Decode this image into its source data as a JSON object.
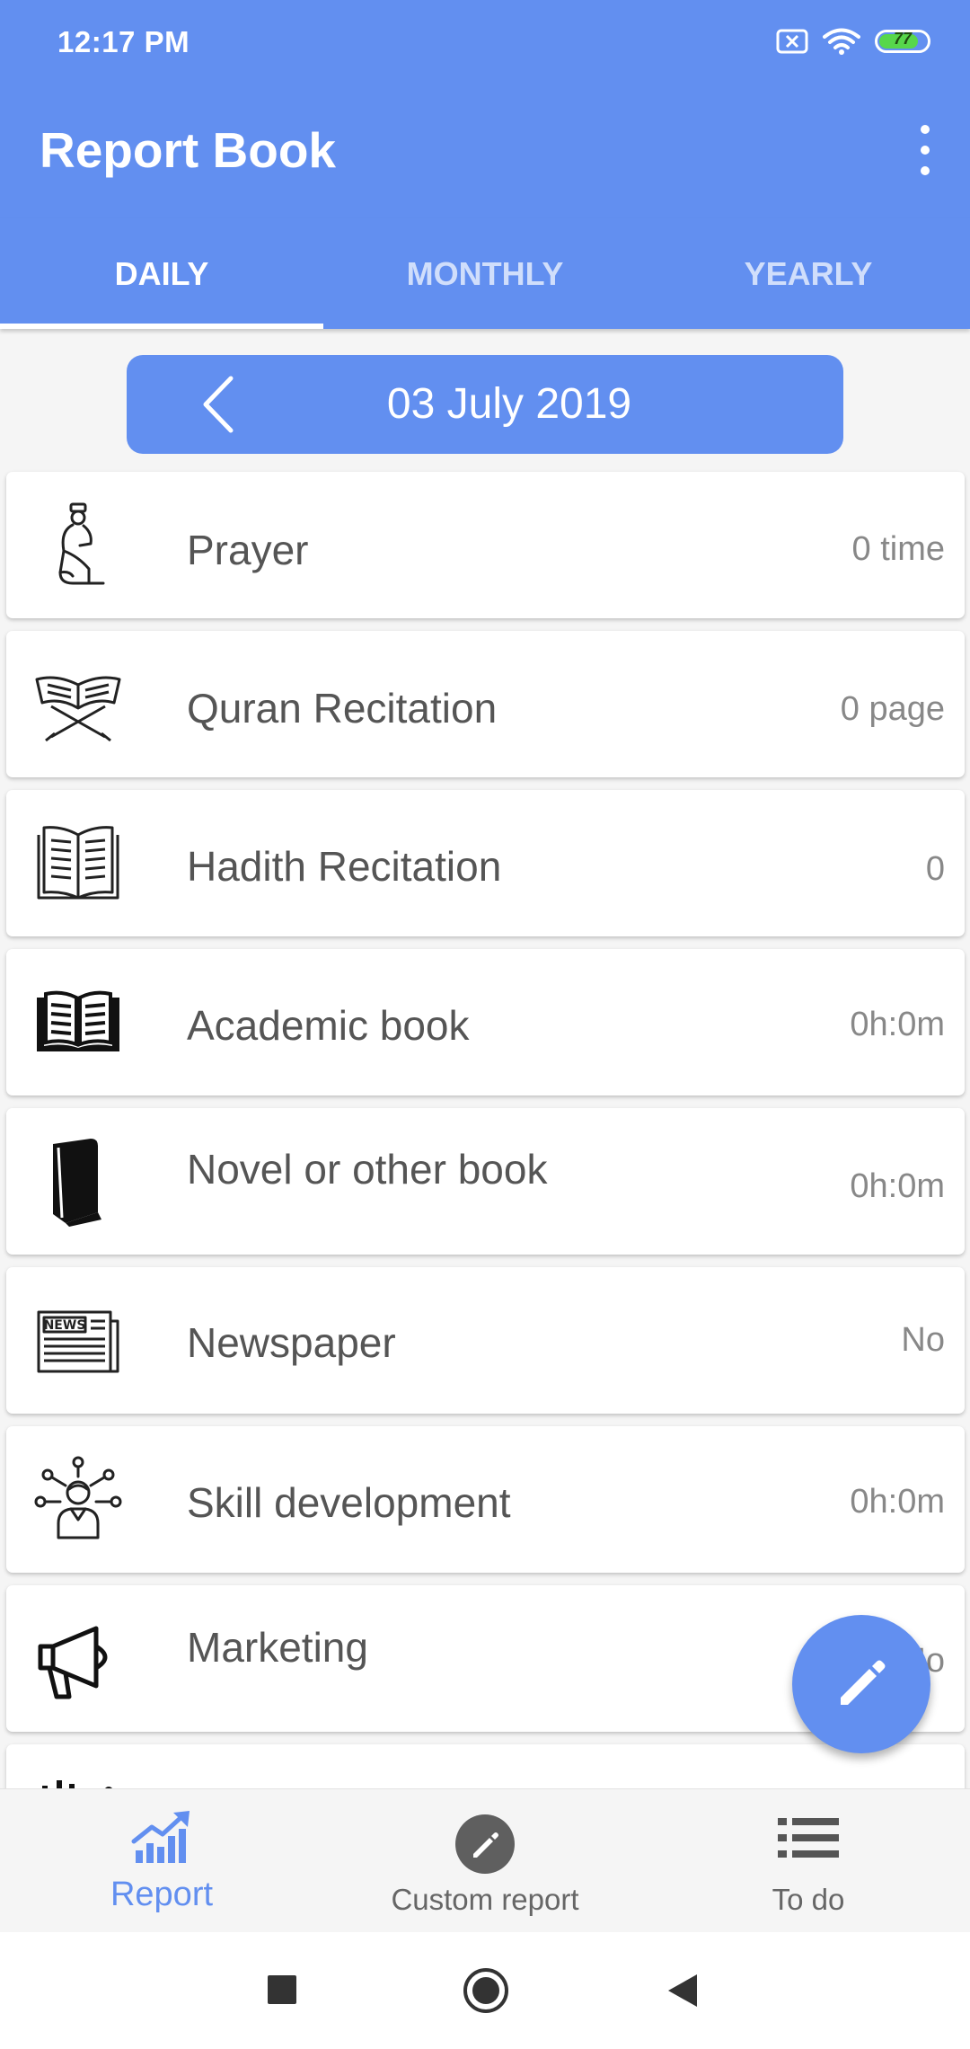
{
  "status_bar": {
    "time": "12:17 PM",
    "battery": "77"
  },
  "app_bar": {
    "title": "Report Book",
    "menu_icon": "more-vert-icon"
  },
  "tabs": [
    {
      "label": "DAILY",
      "active": true
    },
    {
      "label": "MONTHLY",
      "active": false
    },
    {
      "label": "YEARLY",
      "active": false
    }
  ],
  "date_selector": {
    "date": "03 July 2019",
    "prev_icon": "chevron-left-icon"
  },
  "items": [
    {
      "label": "Prayer",
      "value": "0 time",
      "icon": "prayer-icon"
    },
    {
      "label": "Quran Recitation",
      "value": "0 page",
      "icon": "quran-icon"
    },
    {
      "label": "Hadith Recitation",
      "value": "0",
      "icon": "hadith-book-icon"
    },
    {
      "label": "Academic book",
      "value": "0h:0m",
      "icon": "open-book-icon"
    },
    {
      "label": "Novel or other book",
      "value": "0h:0m",
      "icon": "closed-book-icon"
    },
    {
      "label": "Newspaper",
      "value": "No",
      "icon": "newspaper-icon"
    },
    {
      "label": "Skill development",
      "value": "0h:0m",
      "icon": "skill-icon"
    },
    {
      "label": "Marketing",
      "value": "No",
      "icon": "megaphone-icon"
    }
  ],
  "newspaper_icon_text": "NEWS",
  "fab": {
    "icon": "pencil-icon"
  },
  "bottom_nav": [
    {
      "label": "Report",
      "icon": "chart-up-icon",
      "active": true
    },
    {
      "label": "Custom report",
      "icon": "edit-circle-icon",
      "active": false
    },
    {
      "label": "To do",
      "icon": "list-icon",
      "active": false
    }
  ],
  "colors": {
    "primary": "#628ff0",
    "background": "#f5f5f5",
    "card": "#ffffff",
    "label": "#555555",
    "value": "#888888"
  }
}
